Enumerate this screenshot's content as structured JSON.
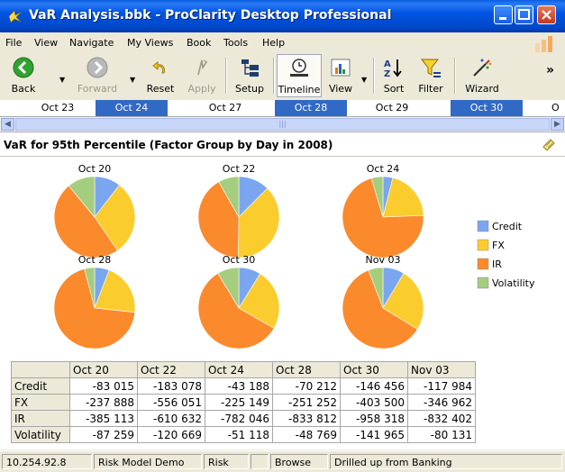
{
  "window": {
    "title": "VaR Analysis.bbk - ProClarity Desktop Professional"
  },
  "menu": [
    "File",
    "View",
    "Navigate",
    "My Views",
    "Book",
    "Tools",
    "Help"
  ],
  "toolbar": {
    "back": "Back",
    "forward": "Forward",
    "reset": "Reset",
    "apply": "Apply",
    "setup": "Setup",
    "timeline": "Timeline",
    "view": "View",
    "sort": "Sort",
    "filter": "Filter",
    "wizard": "Wizard",
    "more": "»"
  },
  "timeline": {
    "dates": [
      "Oct 23",
      "Oct 24",
      "Oct 27",
      "Oct 28",
      "Oct 29",
      "Oct 30",
      "O"
    ],
    "selected": [
      false,
      true,
      false,
      true,
      false,
      true,
      false
    ]
  },
  "view": {
    "title": "VaR for 95th Percentile (Factor Group by Day in 2008)"
  },
  "colors": {
    "Credit": "#7aa6f0",
    "FX": "#fbcc2d",
    "IR": "#fb8a2d",
    "Volatility": "#a5cd7e"
  },
  "chart_data": {
    "type": "pie",
    "title": "VaR for 95th Percentile (Factor Group by Day in 2008)",
    "legend_position": "right",
    "series_names": [
      "Credit",
      "FX",
      "IR",
      "Volatility"
    ],
    "pies": [
      {
        "label": "Oct 20",
        "values": [
          83015,
          237888,
          385113,
          87259
        ]
      },
      {
        "label": "Oct 22",
        "values": [
          183078,
          556051,
          610632,
          120669
        ]
      },
      {
        "label": "Oct 24",
        "values": [
          43188,
          225149,
          782046,
          51118
        ]
      },
      {
        "label": "Oct 28",
        "values": [
          70212,
          251252,
          833812,
          48769
        ]
      },
      {
        "label": "Oct 30",
        "values": [
          146456,
          403500,
          958318,
          141965
        ]
      },
      {
        "label": "Nov 03",
        "values": [
          117984,
          346962,
          832402,
          80131
        ]
      }
    ]
  },
  "grid": {
    "columns": [
      "Oct 20",
      "Oct 22",
      "Oct 24",
      "Oct 28",
      "Oct 30",
      "Nov 03"
    ],
    "rows": [
      {
        "label": "Credit",
        "values": [
          "-83 015",
          "-183 078",
          "-43 188",
          "-70 212",
          "-146 456",
          "-117 984"
        ]
      },
      {
        "label": "FX",
        "values": [
          "-237 888",
          "-556 051",
          "-225 149",
          "-251 252",
          "-403 500",
          "-346 962"
        ]
      },
      {
        "label": "IR",
        "values": [
          "-385 113",
          "-610 632",
          "-782 046",
          "-833 812",
          "-958 318",
          "-832 402"
        ]
      },
      {
        "label": "Volatility",
        "values": [
          "-87 259",
          "-120 669",
          "-51 118",
          "-48 769",
          "-141 965",
          "-80 131"
        ]
      }
    ]
  },
  "status": {
    "server": "10.254.92.8",
    "database": "Risk Model Demo",
    "cube": "Risk",
    "empty": "",
    "mode": "Browse",
    "message": "Drilled up from Banking"
  }
}
